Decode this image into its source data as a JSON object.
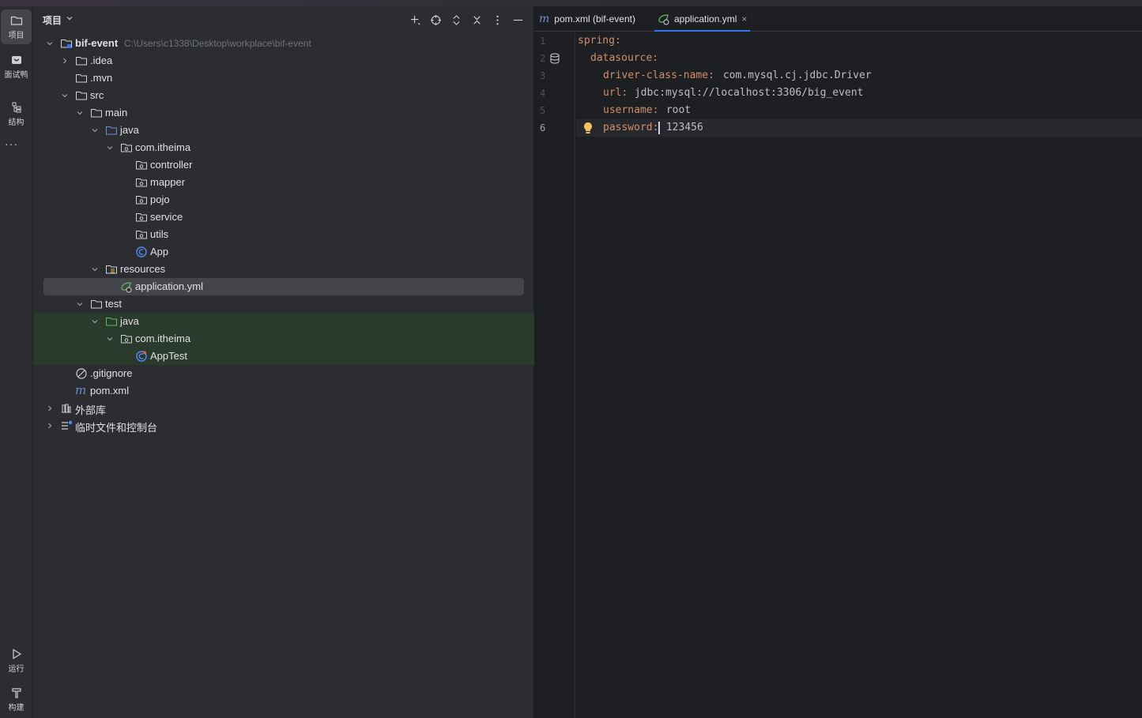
{
  "activity_bar": {
    "items": [
      {
        "label": "项目",
        "icon": "folder-icon"
      },
      {
        "label": "面试鸭",
        "icon": "duck-icon"
      },
      {
        "label": "结构",
        "icon": "structure-icon"
      }
    ],
    "more": "···",
    "bottom": [
      {
        "label": "运行",
        "icon": "run-icon"
      },
      {
        "label": "构建",
        "icon": "build-icon"
      }
    ]
  },
  "project_panel": {
    "title": "项目",
    "root": {
      "name": "bif-event",
      "path": "C:\\Users\\c1338\\Desktop\\workplace\\bif-event"
    },
    "tree": [
      {
        "label": ".idea"
      },
      {
        "label": ".mvn"
      },
      {
        "label": "src"
      },
      {
        "label": "main"
      },
      {
        "label": "java"
      },
      {
        "label": "com.itheima"
      },
      {
        "label": "controller"
      },
      {
        "label": "mapper"
      },
      {
        "label": "pojo"
      },
      {
        "label": "service"
      },
      {
        "label": "utils"
      },
      {
        "label": "App"
      },
      {
        "label": "resources"
      },
      {
        "label": "application.yml"
      },
      {
        "label": "test"
      },
      {
        "label": "java"
      },
      {
        "label": "com.itheima"
      },
      {
        "label": "AppTest"
      },
      {
        "label": ".gitignore"
      },
      {
        "label": "pom.xml"
      },
      {
        "label": "外部库"
      },
      {
        "label": "临时文件和控制台"
      }
    ]
  },
  "editor": {
    "tabs": [
      {
        "label": "pom.xml (bif-event)",
        "prefix": "m"
      },
      {
        "label": "application.yml",
        "close": "×"
      }
    ],
    "line_numbers": [
      "1",
      "2",
      "3",
      "4",
      "5",
      "6"
    ],
    "lines": [
      {
        "key": "spring:",
        "value": ""
      },
      {
        "key": "datasource:",
        "value": ""
      },
      {
        "key": "driver-class-name:",
        "value": " com.mysql.cj.jdbc.Driver"
      },
      {
        "key": "url:",
        "value": " jdbc:mysql://localhost:3306/big_event"
      },
      {
        "key": "username:",
        "value": " root"
      },
      {
        "key": "password:",
        "value": " 123456"
      }
    ],
    "current_line": 6
  },
  "colors": {
    "accent": "#3574f0",
    "key": "#cf8e6d",
    "selection": "#43454a",
    "test_folder_bg": "#2a3a2c"
  }
}
